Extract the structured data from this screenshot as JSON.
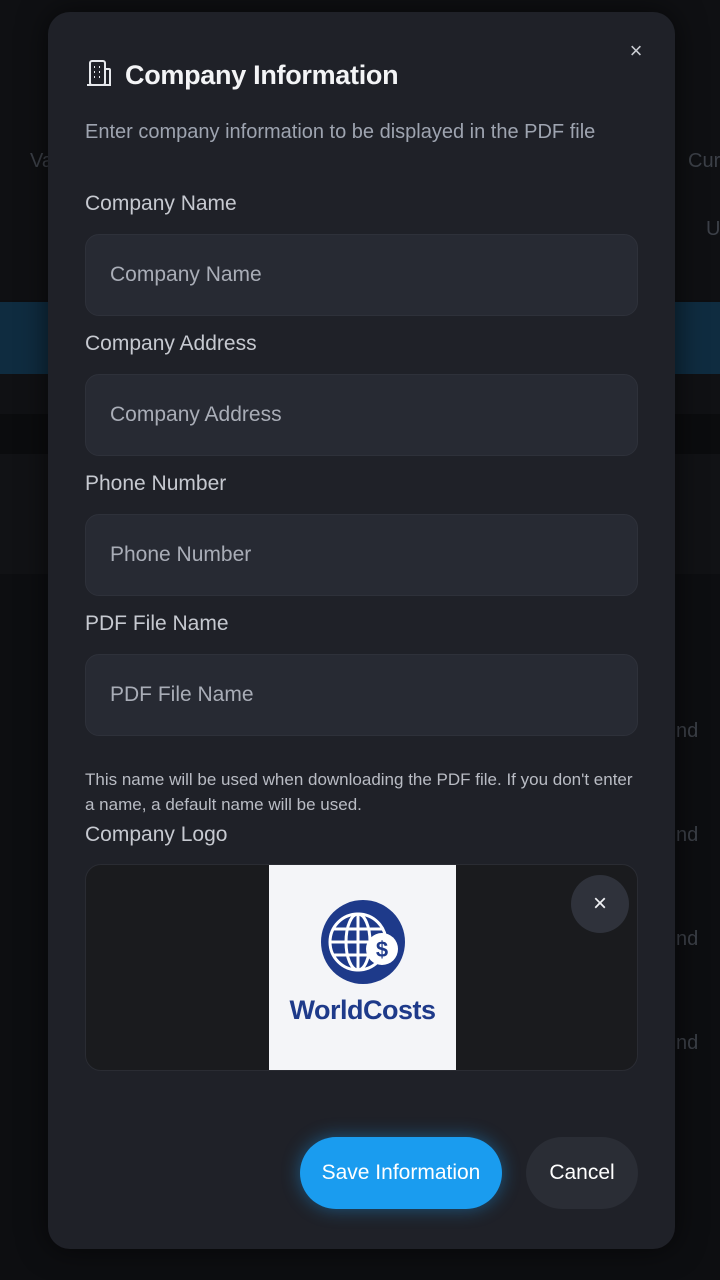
{
  "modal": {
    "title": "Company Information",
    "subtitle": "Enter company information to be displayed in the PDF file",
    "close": "×"
  },
  "fields": {
    "company_name": {
      "label": "Company Name",
      "placeholder": "Company Name",
      "value": ""
    },
    "company_address": {
      "label": "Company Address",
      "placeholder": "Company Address",
      "value": ""
    },
    "phone_number": {
      "label": "Phone Number",
      "placeholder": "Phone Number",
      "value": ""
    },
    "pdf_file_name": {
      "label": "PDF File Name",
      "placeholder": "PDF File Name",
      "value": ""
    }
  },
  "pdf_hint": "This name will be used when downloading the PDF file. If you don't enter a name, a default name will be used.",
  "logo": {
    "label": "Company Logo",
    "wordmark": "WorldCosts",
    "remove": "×"
  },
  "actions": {
    "save": "Save Information",
    "cancel": "Cancel"
  },
  "background": {
    "text_left": "Va",
    "text_right_top": "Cur",
    "text_right_field": "U",
    "row_suffix": "nd"
  },
  "colors": {
    "accent": "#1a9cef",
    "modal_bg": "#1f2128",
    "field_bg": "#272a33",
    "logo_blue": "#1e3a8a"
  },
  "icons": {
    "title_icon": "building-icon",
    "close_icon": "close-icon",
    "logo_mark": "globe-dollar-icon"
  }
}
